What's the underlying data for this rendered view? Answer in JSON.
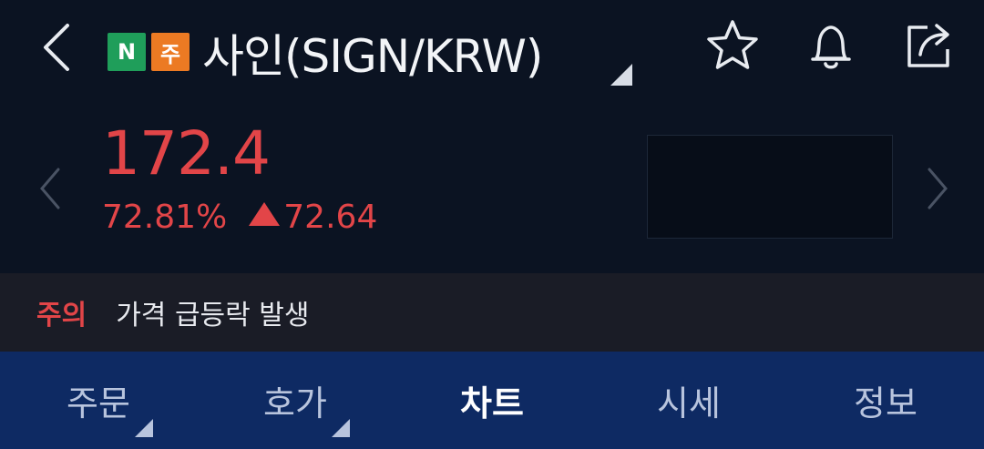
{
  "header": {
    "badge_n": "N",
    "badge_j": "주",
    "title": "사인(SIGN/KRW)",
    "icons": {
      "back": "chevron-left-icon",
      "star": "star-icon",
      "bell": "bell-icon",
      "share": "share-icon"
    }
  },
  "quote": {
    "price": "172.4",
    "change_percent": "72.81%",
    "change_amount": "72.64",
    "direction": "up",
    "color": "#e24548"
  },
  "alert": {
    "tag": "주의",
    "message": "가격 급등락 발생"
  },
  "tabs": [
    {
      "label": "주문",
      "has_caret": true,
      "active": false
    },
    {
      "label": "호가",
      "has_caret": true,
      "active": false
    },
    {
      "label": "차트",
      "has_caret": false,
      "active": true
    },
    {
      "label": "시세",
      "has_caret": false,
      "active": false
    },
    {
      "label": "정보",
      "has_caret": false,
      "active": false
    }
  ],
  "colors": {
    "background": "#0b1322",
    "tab_bar": "#0e2a63",
    "alert_bar": "#1a1c26",
    "up": "#e24548",
    "badge_n": "#1f9e5a",
    "badge_j": "#ec7a23"
  }
}
